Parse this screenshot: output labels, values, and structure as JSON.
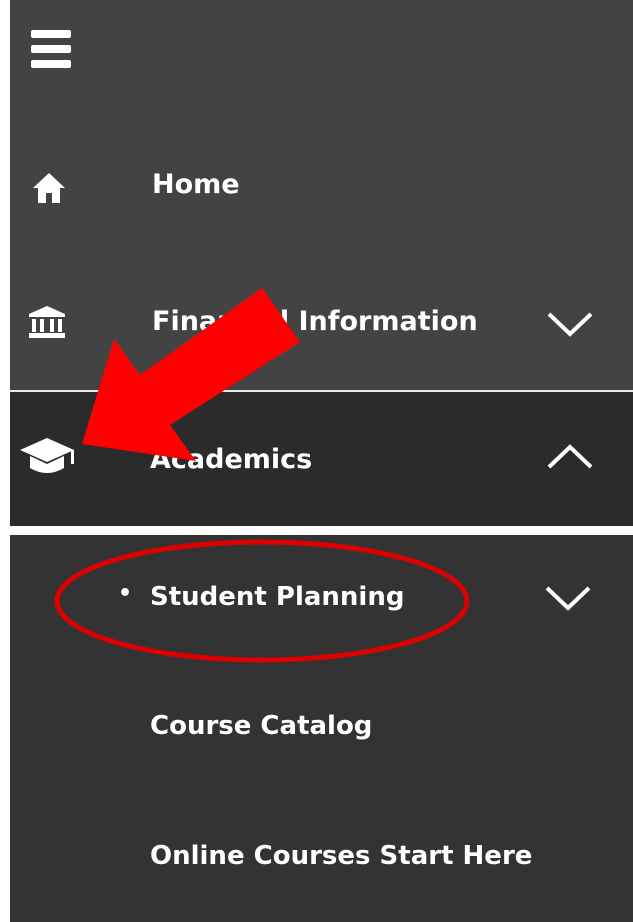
{
  "nav": {
    "menu_icon": "hamburger-icon",
    "items": [
      {
        "label": "Home",
        "icon": "home-icon"
      },
      {
        "label": "Financial Information",
        "icon": "bank-icon",
        "chevron": "chevron-down-icon"
      },
      {
        "label": "Academics",
        "icon": "graduation-cap-icon",
        "chevron": "chevron-up-icon",
        "expanded": true
      }
    ],
    "sub_items": [
      {
        "label": "Student Planning",
        "bullet": "•",
        "chevron": "chevron-down-icon",
        "active": true
      },
      {
        "label": "Course Catalog"
      },
      {
        "label": "Online Courses Start Here"
      }
    ]
  },
  "annotations": {
    "arrow_color": "#ff0000",
    "ellipse_color": "#dd0000"
  },
  "colors": {
    "panel_bg": "#434343",
    "selected_bg": "#2b2b2b",
    "sub_bg": "#333333",
    "text": "#ffffff"
  }
}
